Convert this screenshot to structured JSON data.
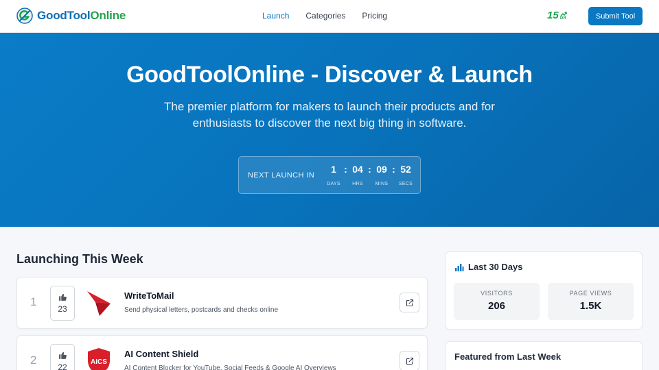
{
  "header": {
    "logo_part1": "GoodTool",
    "logo_part2": "Online",
    "nav": [
      {
        "label": "Launch",
        "active": true
      },
      {
        "label": "Categories",
        "active": false
      },
      {
        "label": "Pricing",
        "active": false
      }
    ],
    "dr_value": "15",
    "dr_label": "DR",
    "submit_label": "Submit Tool"
  },
  "hero": {
    "title": "GoodToolOnline - Discover & Launch",
    "subtitle": "The premier platform for makers to launch their products and for enthusiasts to discover the next big thing in software.",
    "countdown": {
      "label": "NEXT LAUNCH IN",
      "days": "1",
      "days_label": "DAYS",
      "hrs": "04",
      "hrs_label": "HRS",
      "mins": "09",
      "mins_label": "MINS",
      "secs": "52",
      "secs_label": "SECS",
      "sep": ":"
    }
  },
  "main": {
    "section_title": "Launching This Week",
    "products": [
      {
        "rank": "1",
        "votes": "23",
        "name": "WriteToMail",
        "description": "Send physical letters, postcards and checks online",
        "logo_icon": "paper-plane-icon"
      },
      {
        "rank": "2",
        "votes": "22",
        "name": "AI Content Shield",
        "description": "AI Content Blocker for YouTube, Social Feeds & Google AI Overviews",
        "logo_icon": "shield-icon",
        "logo_text": "AICS"
      }
    ]
  },
  "sidebar": {
    "stats_title": "Last 30 Days",
    "visitors_label": "VISITORS",
    "visitors_value": "206",
    "pageviews_label": "PAGE VIEWS",
    "pageviews_value": "1.5K",
    "featured_title": "Featured from Last Week"
  },
  "colors": {
    "brand_blue": "#0a78c2",
    "brand_green": "#22a34a",
    "accent_red": "#d81f2a"
  }
}
